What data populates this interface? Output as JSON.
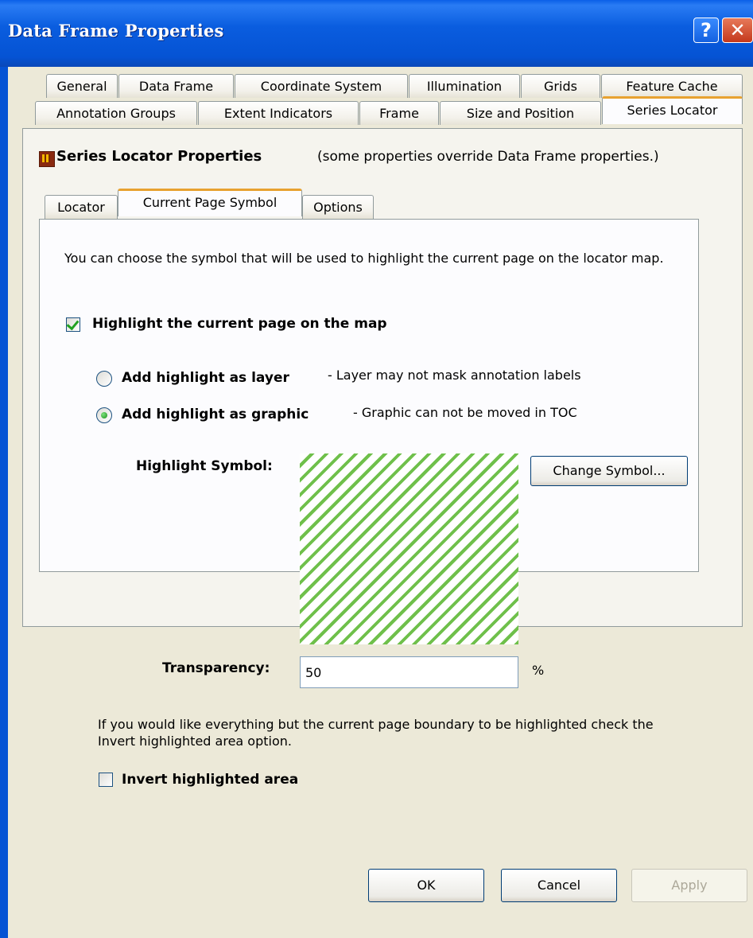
{
  "window": {
    "title": "Data Frame Properties",
    "help_label": "?",
    "close_label": "✕"
  },
  "top_tabs_row1": [
    "General",
    "Data Frame",
    "Coordinate System",
    "Illumination",
    "Grids",
    "Feature Cache"
  ],
  "top_tabs_row2": [
    "Annotation Groups",
    "Extent Indicators",
    "Frame",
    "Size and Position",
    "Series Locator"
  ],
  "active_top_tab": "Series Locator",
  "section": {
    "icon": "series-locator-icon",
    "title": "Series Locator Properties",
    "note": "(some properties override Data Frame properties.)"
  },
  "sub_tabs": [
    "Locator",
    "Current Page Symbol",
    "Options"
  ],
  "active_sub_tab": "Current Page Symbol",
  "content": {
    "description": "You can choose the symbol that will be used to highlight the current page on the locator map.",
    "highlight_checkbox": {
      "label": "Highlight the current page on the map",
      "checked": true
    },
    "radio_layer": {
      "label": "Add highlight as layer",
      "note": "- Layer may not mask annotation labels",
      "selected": false
    },
    "radio_graphic": {
      "label": "Add highlight as graphic",
      "note": "- Graphic can not be moved in TOC",
      "selected": true
    },
    "symbol_label": "Highlight Symbol:",
    "symbol_colors": {
      "hatch": "#6fc04b",
      "background": "#ffffff"
    },
    "change_symbol_button": "Change Symbol...",
    "transparency_label": "Transparency:",
    "transparency_value": "50",
    "transparency_unit": "%",
    "invert_note": "If you would like everything but the current page boundary to be highlighted check the Invert highlighted area option.",
    "invert_checkbox": {
      "label": "Invert highlighted area",
      "checked": false
    }
  },
  "footer": {
    "ok": "OK",
    "cancel": "Cancel",
    "apply": "Apply"
  }
}
